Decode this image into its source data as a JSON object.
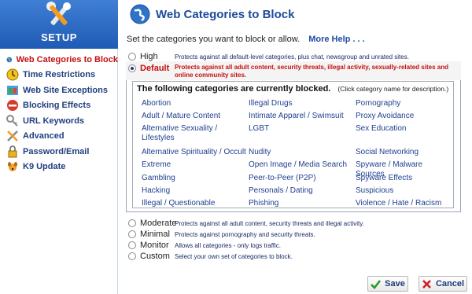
{
  "sidebar": {
    "banner_label": "SETUP",
    "items": [
      {
        "label": "Web Categories to Block",
        "icon": "globe-icon",
        "active": true
      },
      {
        "label": "Time Restrictions",
        "icon": "clock-icon"
      },
      {
        "label": "Web Site Exceptions",
        "icon": "exceptions-icon"
      },
      {
        "label": "Blocking Effects",
        "icon": "blocking-effects-icon"
      },
      {
        "label": "URL Keywords",
        "icon": "key-icon"
      },
      {
        "label": "Advanced",
        "icon": "tools-icon"
      },
      {
        "label": "Password/Email",
        "icon": "lock-icon"
      },
      {
        "label": "K9 Update",
        "icon": "k9-dog-icon"
      }
    ]
  },
  "header": {
    "title": "Web Categories to Block"
  },
  "intro": {
    "text": "Set the categories you want to block or allow.",
    "more_help": "More Help . . ."
  },
  "levels": [
    {
      "name": "High",
      "desc": "Protects against all default-level categories, plus chat, newsgroup and unrated sites.",
      "selected": false
    },
    {
      "name": "Default",
      "desc": "Protects against all adult content, security threats, illegal activity, sexually-related sites and online community sites.",
      "selected": true
    },
    {
      "name": "Moderate",
      "desc": "Protects against all adult content, security threats and illegal activity.",
      "selected": false
    },
    {
      "name": "Minimal",
      "desc": "Protects against pornography and security threats.",
      "selected": false
    },
    {
      "name": "Monitor",
      "desc": "Allows all categories - only logs traffic.",
      "selected": false
    },
    {
      "name": "Custom",
      "desc": "Select your own set of categories to block.",
      "selected": false
    }
  ],
  "blocked": {
    "heading": "The following categories are currently blocked.",
    "note": "(Click category name for description.)",
    "columns": [
      [
        "Abortion",
        "Adult / Mature Content",
        "Alternative Sexuality / Lifestyles",
        "Alternative Spirituality / Occult",
        "Extreme",
        "Gambling",
        "Hacking",
        "Illegal / Questionable"
      ],
      [
        "Illegal Drugs",
        "Intimate Apparel / Swimsuit",
        "LGBT",
        "Nudity",
        "Open Image / Media Search",
        "Peer-to-Peer (P2P)",
        "Personals / Dating",
        "Phishing"
      ],
      [
        "Pornography",
        "Proxy Avoidance",
        "Sex Education",
        "Social Networking",
        "Spyware / Malware Sources",
        "Spyware Effects",
        "Suspicious",
        "Violence / Hate / Racism"
      ]
    ]
  },
  "buttons": {
    "save": "Save",
    "cancel": "Cancel"
  },
  "colors": {
    "accent": "#1c4a9a",
    "selected": "#c51010",
    "link": "#1f3f8f",
    "banner": "#2f6cc8",
    "save_icon": "#2a9a2a",
    "cancel_icon": "#d02020"
  }
}
